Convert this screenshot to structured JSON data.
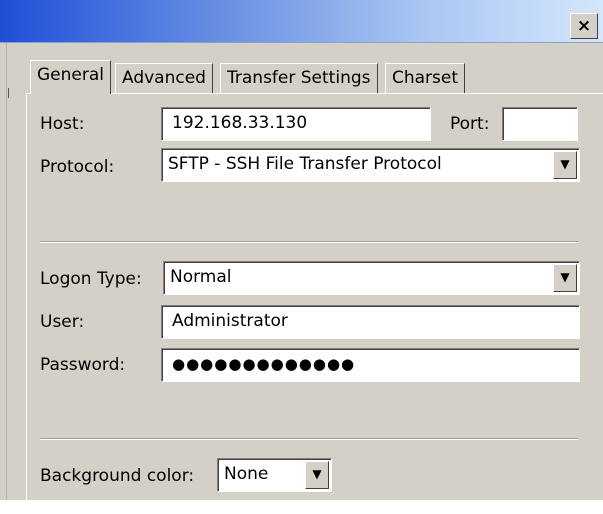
{
  "window": {
    "close_label": "×"
  },
  "tabs": [
    {
      "label": "General",
      "active": true
    },
    {
      "label": "Advanced"
    },
    {
      "label": "Transfer Settings"
    },
    {
      "label": "Charset"
    }
  ],
  "form": {
    "host_label": "Host:",
    "host_value": "192.168.33.130",
    "port_label": "Port:",
    "port_value": "",
    "protocol_label": "Protocol:",
    "protocol_value": "SFTP - SSH File Transfer Protocol",
    "logon_type_label": "Logon Type:",
    "logon_type_value": "Normal",
    "user_label": "User:",
    "user_value": "Administrator",
    "password_label": "Password:",
    "password_value": "●●●●●●●●●●●●●",
    "bgcolor_label": "Background color:",
    "bgcolor_value": "None"
  },
  "icons": {
    "dropdown": "chevron-down-icon",
    "close": "close-icon"
  }
}
